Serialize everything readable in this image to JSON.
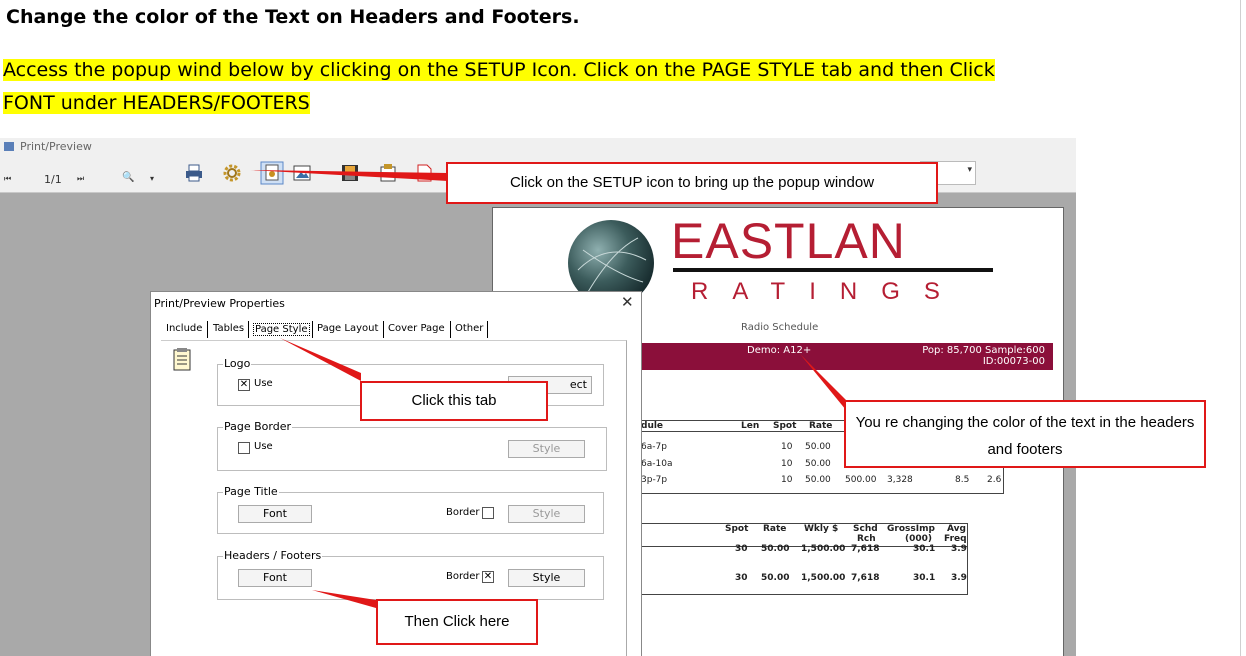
{
  "heading": "Change the color of the Text on Headers and Footers.",
  "instruction": {
    "line1": "Access the popup wind below by clicking on the SETUP Icon.  Click on the PAGE STYLE tab and then Click",
    "line2": "FONT under HEADERS/FOOTERS"
  },
  "window": {
    "title": "Print/Preview",
    "page_counter": "1/1",
    "nav_first": "⏮",
    "nav_last": "⏭",
    "zoom_glyph": "🔍"
  },
  "report": {
    "brand": "EASTLAN",
    "sub_brand": "RATINGS",
    "subtitle": "Radio Schedule",
    "demo": "Demo: A12+",
    "pop": "Pop: 85,700  Sample:600",
    "id": "ID:00073-00",
    "table1_headers": [
      "dule",
      "Len",
      "Spot",
      "Rate"
    ],
    "table1_rows": [
      [
        "6a-7p",
        "10",
        "50.00"
      ],
      [
        "6a-10a",
        "10",
        "50.00"
      ],
      [
        "3p-7p",
        "10",
        "50.00",
        "500.00",
        "3,328",
        "8.5",
        "2.6"
      ]
    ],
    "table2_headers": [
      "Spot",
      "Rate",
      "Wkly $",
      "Schd",
      "Rch",
      "GrossImp",
      "(000)",
      "Avg",
      "Freq"
    ],
    "table2_rows": [
      [
        "30",
        "50.00",
        "1,500.00",
        "7,618",
        "30.1",
        "3.9"
      ],
      [
        "30",
        "50.00",
        "1,500.00",
        "7,618",
        "30.1",
        "3.9"
      ]
    ]
  },
  "dialog": {
    "title": "Print/Preview Properties",
    "close": "✕",
    "tabs": [
      "Include",
      "Tables",
      "Page Style",
      "Page Layout",
      "Cover Page",
      "Other"
    ],
    "groups": {
      "logo": {
        "label": "Logo",
        "use": "Use",
        "select": "ect"
      },
      "page_border": {
        "label": "Page Border",
        "use": "Use",
        "style": "Style"
      },
      "page_title": {
        "label": "Page Title",
        "font": "Font",
        "border": "Border",
        "style": "Style"
      },
      "headers_footers": {
        "label": "Headers / Footers",
        "font": "Font",
        "border": "Border",
        "style": "Style"
      }
    }
  },
  "callouts": {
    "setup": "Click on the SETUP icon to bring up the popup window",
    "tab": "Click this tab",
    "changing": "You re changing the color of the text in the headers and footers",
    "then": "Then Click here"
  },
  "colors": {
    "highlight": "#ffff00",
    "callout_border": "#e01818",
    "brand_red": "#b51e33",
    "demo_bar": "#8b0f3a"
  }
}
